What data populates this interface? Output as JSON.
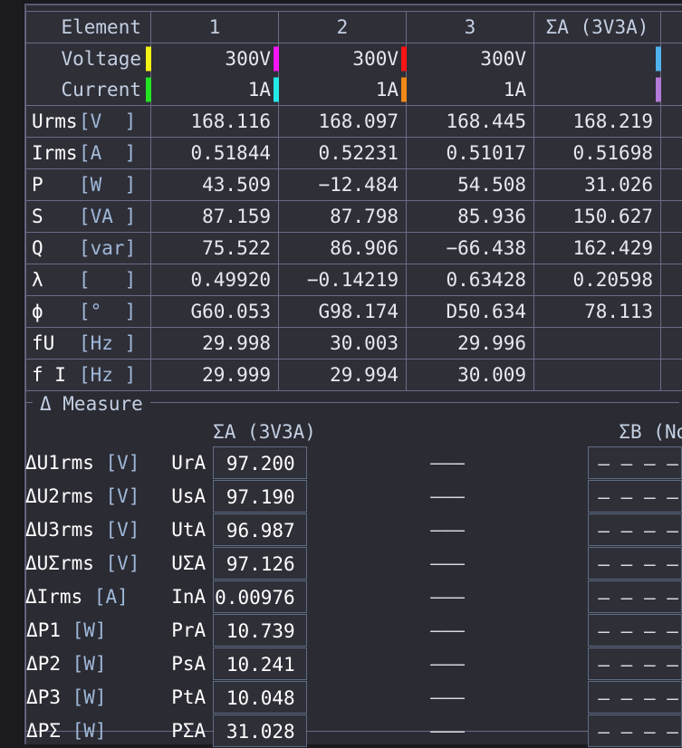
{
  "instrument": {
    "main_table": {
      "header_row": {
        "label": "Element",
        "columns": [
          "1",
          "2",
          "3",
          "ΣA (3V3A)",
          ""
        ]
      },
      "range_rows": [
        {
          "label": "Voltage",
          "values": [
            "300V",
            "300V",
            "300V",
            "",
            ""
          ],
          "chips": [
            "#f3f315",
            "#f715f7",
            "#f71515",
            "",
            "#4fb3ee"
          ]
        },
        {
          "label": "Current",
          "values": [
            "1A",
            "1A",
            "1A",
            "",
            ""
          ],
          "chips": [
            "#23e623",
            "#23e8e8",
            "#f08a16",
            "",
            "#b47ada"
          ]
        }
      ],
      "rows": [
        {
          "sym": "Urms",
          "unit": "[V  ]",
          "values": [
            "168.116",
            "168.097",
            "168.445",
            "168.219",
            ""
          ]
        },
        {
          "sym": " Irms",
          "unit": "[A  ]",
          "values": [
            "0.51844",
            "0.52231",
            "0.51017",
            "0.51698",
            ""
          ]
        },
        {
          "sym": "P",
          "unit": "[W  ]",
          "values": [
            "43.509",
            "−12.484",
            "54.508",
            "31.026",
            ""
          ]
        },
        {
          "sym": "S",
          "unit": "[VA ]",
          "values": [
            "87.159",
            "87.798",
            "85.936",
            "150.627",
            ""
          ]
        },
        {
          "sym": "Q",
          "unit": "[var]",
          "values": [
            "75.522",
            "86.906",
            "−66.438",
            "162.429",
            ""
          ]
        },
        {
          "sym": "λ",
          "unit": "[   ]",
          "values": [
            "0.49920",
            "−0.14219",
            "0.63428",
            "0.20598",
            ""
          ]
        },
        {
          "sym": "ϕ",
          "unit": "[°  ]",
          "values": [
            "G60.053",
            "G98.174",
            "D50.634",
            "78.113",
            ""
          ]
        },
        {
          "sym": "fU",
          "unit": "[Hz ]",
          "values": [
            "29.998",
            "30.003",
            "29.996",
            "",
            ""
          ]
        },
        {
          "sym": "f I",
          "unit": "[Hz ]",
          "values": [
            "29.999",
            "29.994",
            "30.009",
            "",
            ""
          ]
        }
      ]
    },
    "delta_measure": {
      "title": "Δ Measure",
      "col_headers": [
        "ΣA (3V3A)",
        "ΣB (None"
      ],
      "rows": [
        {
          "label": "ΔU1rms",
          "unit": "[V]",
          "sym": "UrA",
          "valueA": "97.200",
          "dash": "———",
          "valueB": "— — — — — — — — —"
        },
        {
          "label": "ΔU2rms",
          "unit": "[V]",
          "sym": "UsA",
          "valueA": "97.190",
          "dash": "———",
          "valueB": "— — — — — — — — —"
        },
        {
          "label": "ΔU3rms",
          "unit": "[V]",
          "sym": "UtA",
          "valueA": "96.987",
          "dash": "———",
          "valueB": "— — — — — — — — —"
        },
        {
          "label": "ΔUΣrms",
          "unit": "[V]",
          "sym": "UΣA",
          "valueA": "97.126",
          "dash": "———",
          "valueB": "— — — — — — — — —"
        },
        {
          "label": "ΔIrms",
          "unit": "[A]",
          "sym": "InA",
          "valueA": "0.00976",
          "dash": "———",
          "valueB": "— — — — — — — — —"
        },
        {
          "label": "ΔP1",
          "unit": "[W]",
          "sym": "PrA",
          "valueA": "10.739",
          "dash": "———",
          "valueB": "— — — — — — — — —"
        },
        {
          "label": "ΔP2",
          "unit": "[W]",
          "sym": "PsA",
          "valueA": "10.241",
          "dash": "———",
          "valueB": "— — — — — — — — —"
        },
        {
          "label": "ΔP3",
          "unit": "[W]",
          "sym": "PtA",
          "valueA": "10.048",
          "dash": "———",
          "valueB": "— — — — — — — — —"
        },
        {
          "label": "ΔPΣ",
          "unit": "[W]",
          "sym": "PΣA",
          "valueA": "31.028",
          "dash": "———",
          "valueB": "— — — — — — — — —"
        }
      ]
    }
  }
}
